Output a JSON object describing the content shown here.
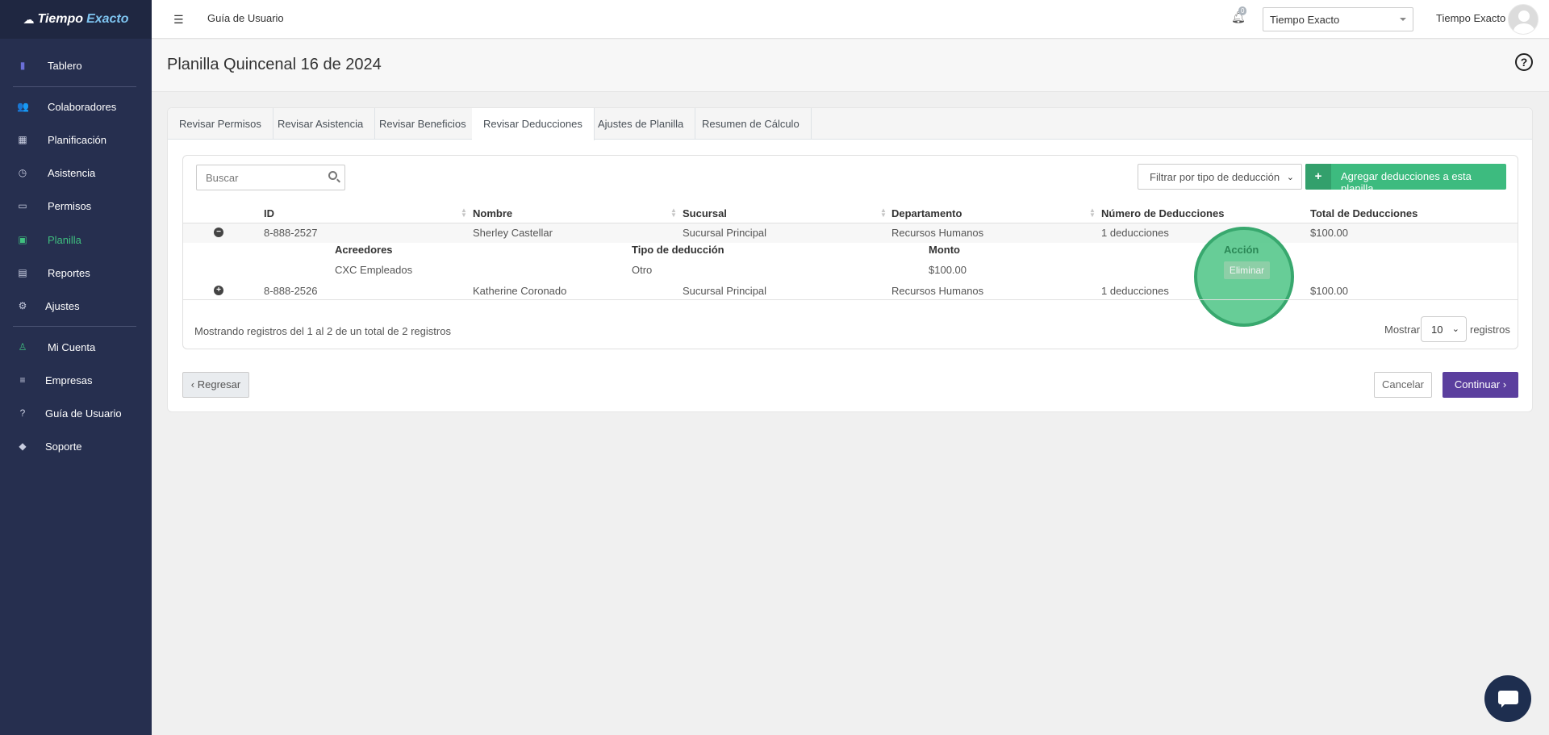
{
  "brand": {
    "part1": "Tiempo",
    "part2": "Exacto"
  },
  "sidebar": {
    "items": [
      {
        "label": "Tablero",
        "icon": "chart-bar-icon",
        "glyph": "▮"
      },
      {
        "label": "Colaboradores",
        "icon": "users-icon",
        "glyph": "👥"
      },
      {
        "label": "Planificación",
        "icon": "calendar-icon",
        "glyph": "▦"
      },
      {
        "label": "Asistencia",
        "icon": "clock-icon",
        "glyph": "◷"
      },
      {
        "label": "Permisos",
        "icon": "inbox-icon",
        "glyph": "▭"
      },
      {
        "label": "Planilla",
        "icon": "money-icon",
        "glyph": "▣"
      },
      {
        "label": "Reportes",
        "icon": "file-icon",
        "glyph": "▤"
      },
      {
        "label": "Ajustes",
        "icon": "gear-icon",
        "glyph": "⚙"
      },
      {
        "label": "Mi Cuenta",
        "icon": "user-icon",
        "glyph": "♙"
      },
      {
        "label": "Empresas",
        "icon": "sliders-icon",
        "glyph": "≡"
      },
      {
        "label": "Guía de Usuario",
        "icon": "question-icon",
        "glyph": "?"
      },
      {
        "label": "Soporte",
        "icon": "shield-icon",
        "glyph": "◆"
      }
    ],
    "active_color": "#3fbf7f"
  },
  "topbar": {
    "guide_label": "Guía de Usuario",
    "notifications_count": "0",
    "company_selected": "Tiempo Exacto",
    "user_name": "Tiempo Exacto"
  },
  "page": {
    "title": "Planilla Quincenal 16 de 2024"
  },
  "tabs": [
    "Revisar Permisos",
    "Revisar Asistencia",
    "Revisar Beneficios",
    "Revisar Deducciones",
    "Ajustes de Planilla",
    "Resumen de Cálculo"
  ],
  "active_tab_index": 3,
  "toolbar": {
    "search_placeholder": "Buscar",
    "filter_label": "Filtrar por tipo de deducción",
    "add_label": "Agregar deducciones a esta planilla"
  },
  "table": {
    "headers": [
      "ID",
      "Nombre",
      "Sucursal",
      "Departamento",
      "Número de Deducciones",
      "Total de Deducciones"
    ],
    "rows": [
      {
        "id": "8-888-2527",
        "nombre": "Sherley Castellar",
        "sucursal": "Sucursal Principal",
        "departamento": "Recursos Humanos",
        "numero": "1 deducciones",
        "total": "$100.00",
        "expanded": true
      },
      {
        "id": "8-888-2526",
        "nombre": "Katherine Coronado",
        "sucursal": "Sucursal Principal",
        "departamento": "Recursos Humanos",
        "numero": "1 deducciones",
        "total": "$100.00",
        "expanded": false
      }
    ],
    "detail": {
      "headers": [
        "Acreedores",
        "Tipo de deducción",
        "Monto",
        "Acción"
      ],
      "row": {
        "acreedor": "CXC Empleados",
        "tipo": "Otro",
        "monto": "$100.00",
        "accion": "Eliminar"
      }
    },
    "info": "Mostrando registros del 1 al 2 de un total de 2 registros",
    "show_label": "Mostrar",
    "page_length": "10",
    "records_label": "registros"
  },
  "footer": {
    "back_label": "Regresar",
    "cancel_label": "Cancelar",
    "continue_label": "Continuar"
  },
  "colors": {
    "sidebar_bg": "#262f4f",
    "accent_green": "#3dbb7f",
    "continue_purple": "#5b3f9e"
  }
}
